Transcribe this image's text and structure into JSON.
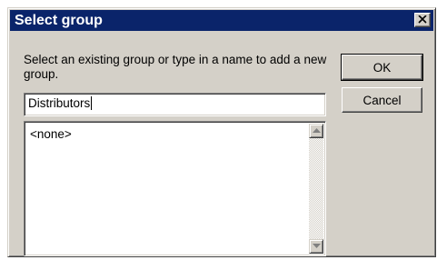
{
  "dialog": {
    "title": "Select group",
    "prompt": "Select an existing group or type in a name to add a new group.",
    "input_value": "Distributors",
    "list_items": [
      "<none>"
    ],
    "ok_label": "OK",
    "cancel_label": "Cancel"
  },
  "icons": {
    "close": "close-icon",
    "scroll_up": "arrow-up-icon",
    "scroll_down": "arrow-down-icon"
  },
  "colors": {
    "titlebar": "#0a246a",
    "face": "#d4d0c8"
  }
}
